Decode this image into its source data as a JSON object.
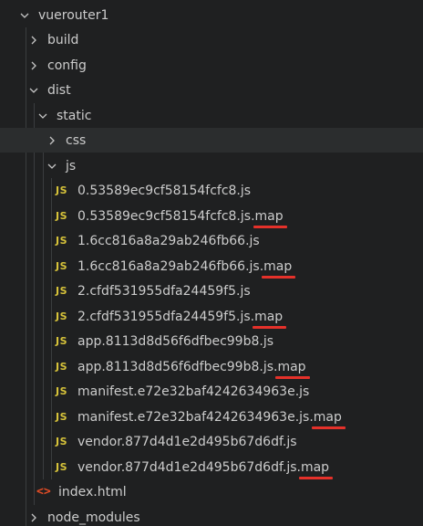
{
  "explorer": {
    "root": {
      "label": "vuerouter1",
      "icon": "chevron-down-icon"
    },
    "build": {
      "label": "build",
      "icon": "chevron-right-icon"
    },
    "config": {
      "label": "config",
      "icon": "chevron-right-icon"
    },
    "dist": {
      "label": "dist",
      "icon": "chevron-down-icon"
    },
    "static": {
      "label": "static",
      "icon": "chevron-down-icon"
    },
    "css": {
      "label": "css",
      "icon": "chevron-right-icon"
    },
    "js": {
      "label": "js",
      "icon": "chevron-down-icon"
    },
    "files": [
      {
        "base": "0.53589ec9cf58154fcfc8.js",
        "ext": ""
      },
      {
        "base": "0.53589ec9cf58154fcfc8.js.",
        "ext": "map"
      },
      {
        "base": "1.6cc816a8a29ab246fb66.js",
        "ext": ""
      },
      {
        "base": "1.6cc816a8a29ab246fb66.js.",
        "ext": "map"
      },
      {
        "base": "2.cfdf531955dfa24459f5.js",
        "ext": ""
      },
      {
        "base": "2.cfdf531955dfa24459f5.js.",
        "ext": "map"
      },
      {
        "base": "app.8113d8d56f6dfbec99b8.js",
        "ext": ""
      },
      {
        "base": "app.8113d8d56f6dfbec99b8.js.",
        "ext": "map"
      },
      {
        "base": "manifest.e72e32baf4242634963e.js",
        "ext": ""
      },
      {
        "base": "manifest.e72e32baf4242634963e.js.",
        "ext": "map"
      },
      {
        "base": "vendor.877d4d1e2d495b67d6df.js",
        "ext": ""
      },
      {
        "base": "vendor.877d4d1e2d495b67d6df.js.",
        "ext": "map"
      }
    ],
    "js_icon_text": "JS",
    "index_html": {
      "label": "index.html",
      "icon_text": "<>"
    },
    "node_modules": {
      "label": "node_modules",
      "icon": "chevron-right-icon"
    },
    "colors": {
      "background": "#1f2021",
      "highlight_row": "#2b2d2e",
      "text": "#cccccc",
      "js_icon": "#d7c33a",
      "html_icon": "#e44d26",
      "underline": "#e5312a"
    }
  }
}
